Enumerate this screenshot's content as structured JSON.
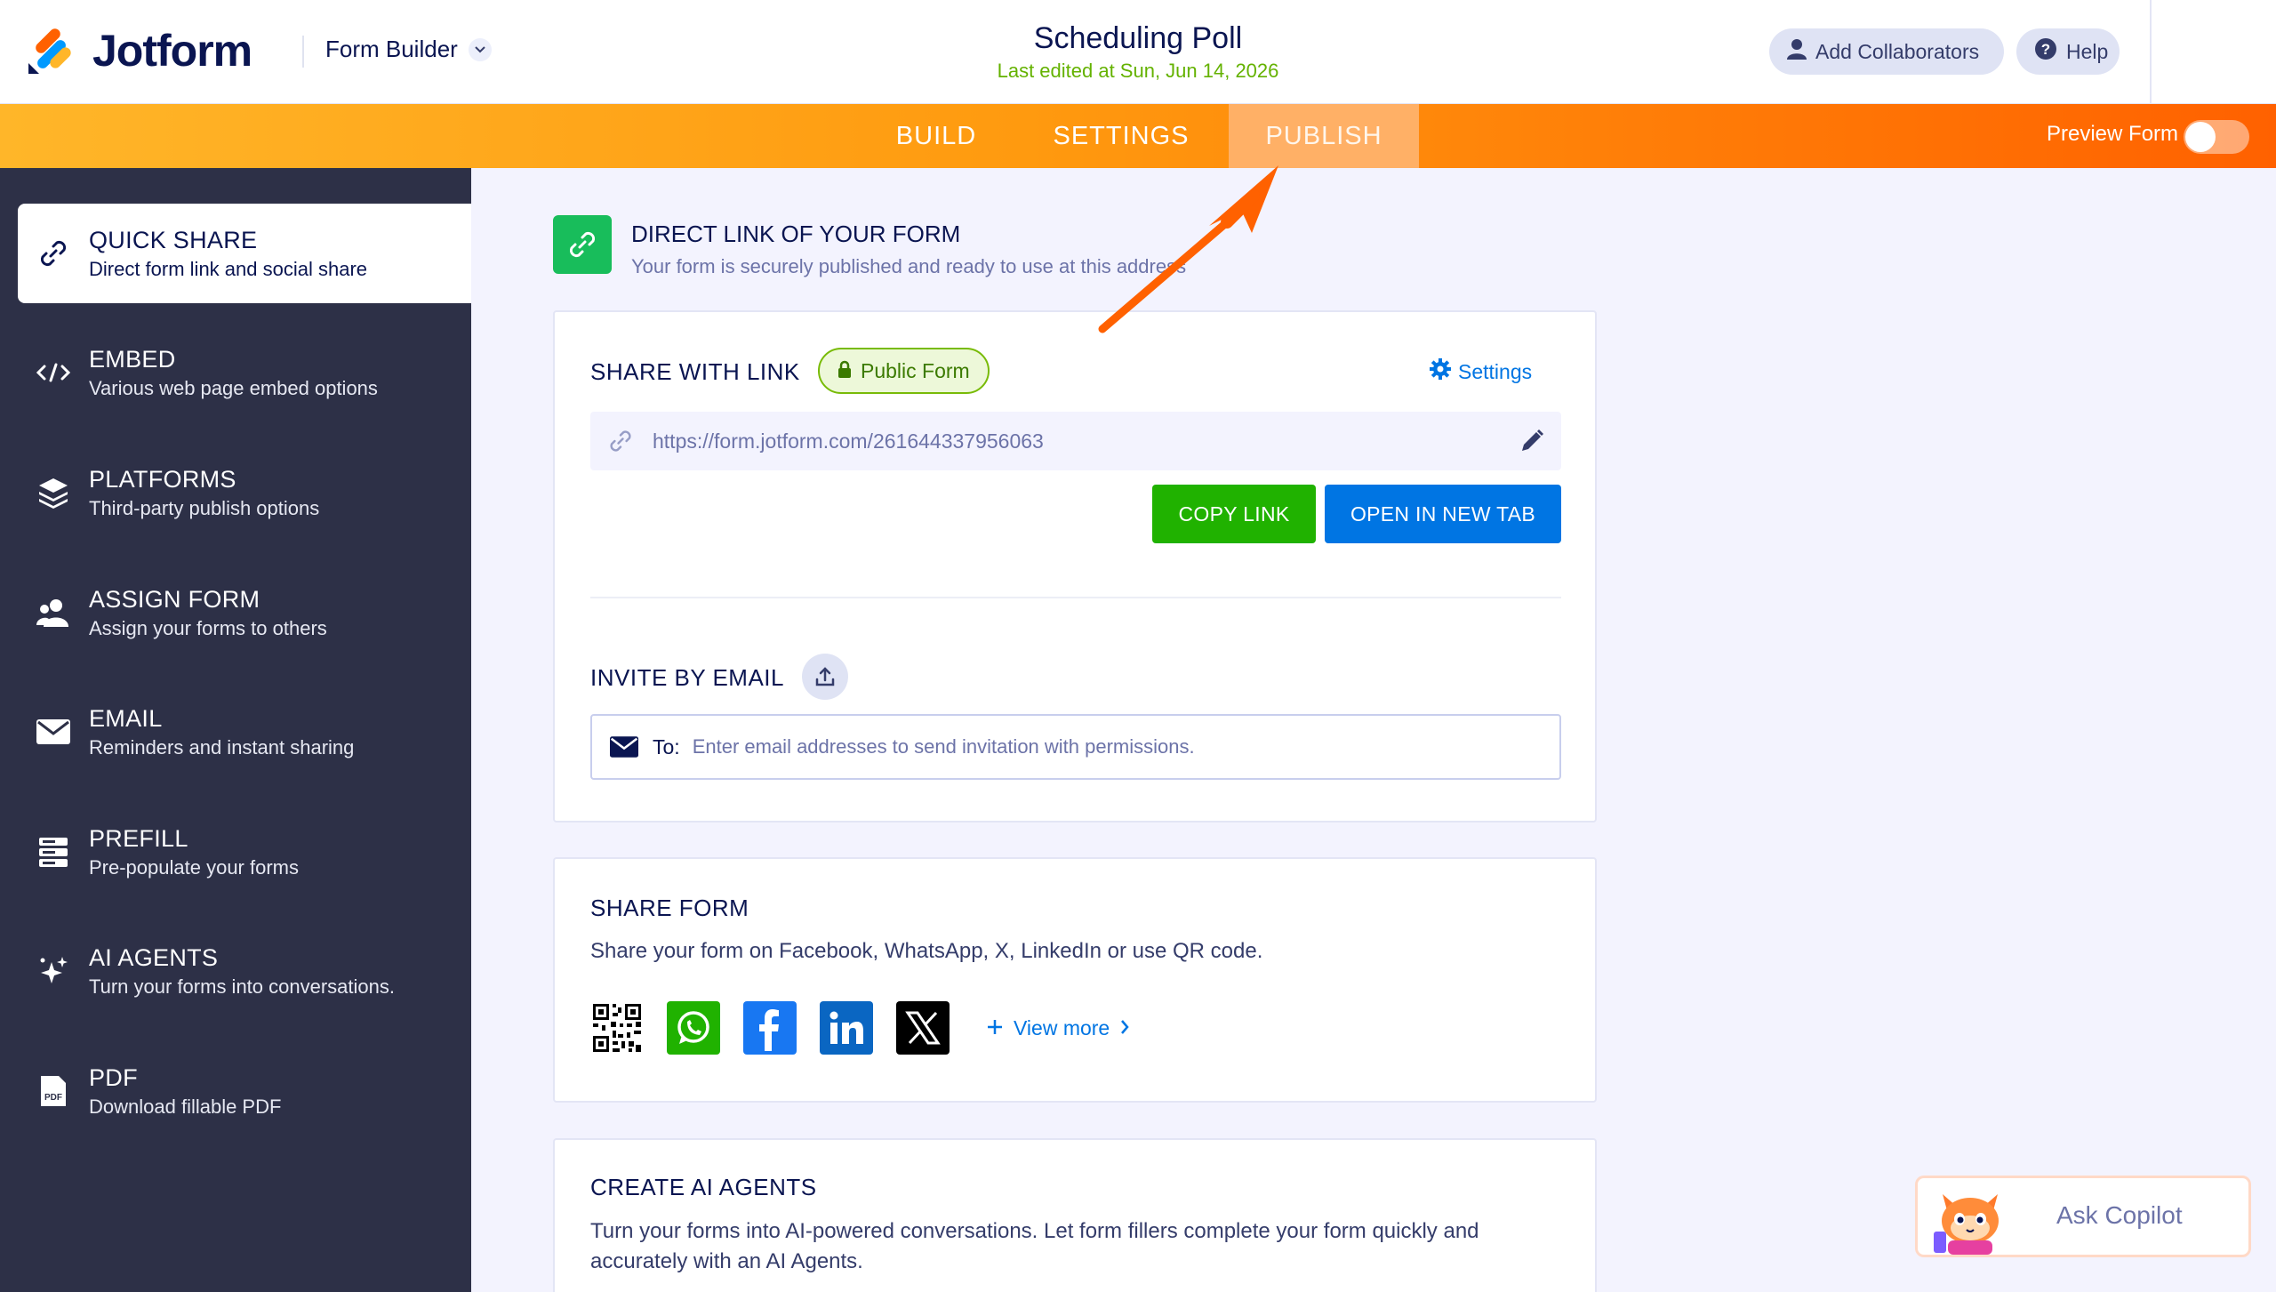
{
  "header": {
    "logo_text": "Jotform",
    "builder_label": "Form Builder",
    "form_title": "Scheduling Poll",
    "last_edited": "Last edited at Sun, Jun 14, 2026",
    "collaborators_label": "Add Collaborators",
    "help_label": "Help"
  },
  "nav": {
    "tabs": [
      {
        "label": "BUILD"
      },
      {
        "label": "SETTINGS"
      },
      {
        "label": "PUBLISH",
        "active": true
      }
    ],
    "preview_label": "Preview Form",
    "preview_on": false
  },
  "sidebar": {
    "items": [
      {
        "title": "QUICK SHARE",
        "desc": "Direct form link and social share",
        "icon": "link-icon",
        "active": true
      },
      {
        "title": "EMBED",
        "desc": "Various web page embed options",
        "icon": "code-icon"
      },
      {
        "title": "PLATFORMS",
        "desc": "Third-party publish options",
        "icon": "layers-icon"
      },
      {
        "title": "ASSIGN FORM",
        "desc": "Assign your forms to others",
        "icon": "users-icon"
      },
      {
        "title": "EMAIL",
        "desc": "Reminders and instant sharing",
        "icon": "envelope-icon"
      },
      {
        "title": "PREFILL",
        "desc": "Pre-populate your forms",
        "icon": "prefill-icon"
      },
      {
        "title": "AI AGENTS",
        "desc": "Turn your forms into conversations.",
        "icon": "sparkle-icon"
      },
      {
        "title": "PDF",
        "desc": "Download fillable PDF",
        "icon": "pdf-icon"
      }
    ]
  },
  "main": {
    "direct_link_title": "DIRECT LINK OF YOUR FORM",
    "direct_link_sub": "Your form is securely published and ready to use at this address",
    "share_with_link": "SHARE WITH LINK",
    "public_badge": "Public Form",
    "settings_label": "Settings",
    "form_url": "https://form.jotform.com/261644337956063",
    "copy_link": "COPY LINK",
    "open_new_tab": "OPEN IN NEW TAB",
    "invite_title": "INVITE BY EMAIL",
    "email_to": "To:",
    "email_placeholder": "Enter email addresses to send invitation with permissions.",
    "share_form_title": "SHARE FORM",
    "share_form_desc": "Share your form on Facebook, WhatsApp, X, LinkedIn or use QR code.",
    "view_more": "View more",
    "ai_title": "CREATE AI AGENTS",
    "ai_desc": "Turn your forms into AI-powered conversations. Let form fillers complete your form quickly and accurately with an AI Agents."
  },
  "copilot": {
    "label": "Ask Copilot"
  },
  "colors": {
    "brand_navy": "#0a1551",
    "sidebar_bg": "#2d3047",
    "orange": "#ff6100",
    "green_button": "#20b200",
    "blue_button": "#0075e3"
  }
}
